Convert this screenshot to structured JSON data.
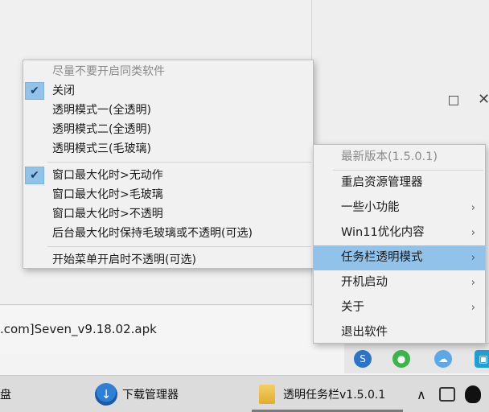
{
  "background": {
    "filename": ".com]Seven_v9.18.02.apk",
    "window_max_symbol": "☐",
    "window_close_symbol": "✕"
  },
  "left_menu": {
    "items": [
      {
        "label": "尽量不要开启同类软件",
        "disabled": true
      },
      {
        "label": "关闭",
        "checked": true
      },
      {
        "label": "透明模式一(全透明)"
      },
      {
        "label": "透明模式二(全透明)"
      },
      {
        "label": "透明模式三(毛玻璃)"
      },
      {
        "label": "窗口最大化时>无动作",
        "checked": true
      },
      {
        "label": "窗口最大化时>毛玻璃"
      },
      {
        "label": "窗口最大化时>不透明"
      },
      {
        "label": "后台最大化时保持毛玻璃或不透明(可选)"
      },
      {
        "label": "开始菜单开启时不透明(可选)"
      }
    ],
    "check_glyph": "✔"
  },
  "right_menu": {
    "items": [
      {
        "label": "最新版本(1.5.0.1)",
        "disabled": true
      },
      {
        "label": "重启资源管理器"
      },
      {
        "label": "一些小功能",
        "submenu": true
      },
      {
        "label": "Win11优化内容",
        "submenu": true
      },
      {
        "label": "任务栏透明模式",
        "submenu": true,
        "highlighted": true
      },
      {
        "label": "开机启动",
        "submenu": true
      },
      {
        "label": "关于",
        "submenu": true
      },
      {
        "label": "退出软件"
      }
    ],
    "arrow_glyph": "›"
  },
  "taskbar": {
    "left_fragment": "盘",
    "download_manager": "下载管理器",
    "active_app": "透明任务栏v1.5.0.1",
    "tray_chevron": "∧"
  },
  "colors": {
    "highlight": "#91c2ea",
    "menu_bg": "#f1f1f1"
  }
}
